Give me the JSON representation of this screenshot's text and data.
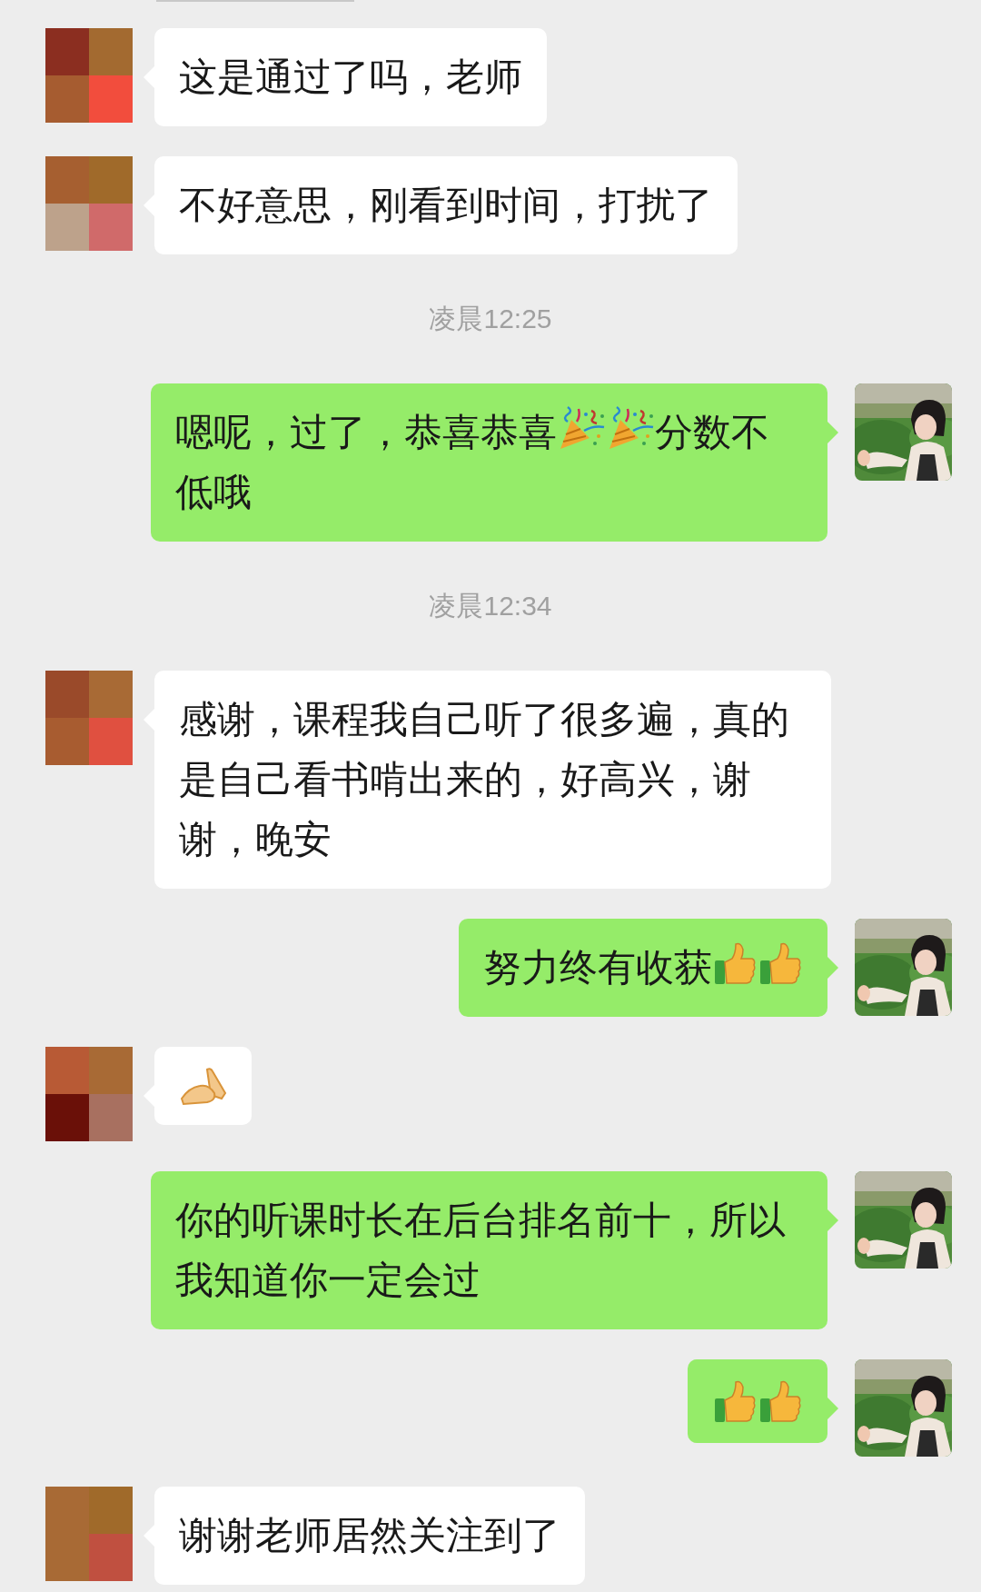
{
  "messages": [
    {
      "kind": "message",
      "outgoing": false,
      "parts": [
        {
          "kind": "text",
          "text": "这是通过了吗，老师"
        }
      ]
    },
    {
      "kind": "message",
      "outgoing": false,
      "parts": [
        {
          "kind": "text",
          "text": "不好意思，刚看到时间，打扰了"
        }
      ]
    },
    {
      "kind": "time",
      "text": "凌晨12:25"
    },
    {
      "kind": "message",
      "outgoing": true,
      "parts": [
        {
          "kind": "text",
          "text": "嗯呢，过了，恭喜恭喜"
        },
        {
          "kind": "party_popper"
        },
        {
          "kind": "party_popper"
        },
        {
          "kind": "text",
          "text": "分数不低哦"
        }
      ]
    },
    {
      "kind": "time",
      "text": "凌晨12:34"
    },
    {
      "kind": "message",
      "outgoing": false,
      "parts": [
        {
          "kind": "text",
          "text": "感谢，课程我自己听了很多遍，真的是自己看书啃出来的，好高兴，谢谢，晚安"
        }
      ]
    },
    {
      "kind": "message",
      "outgoing": true,
      "parts": [
        {
          "kind": "text",
          "text": "努力终有收获"
        },
        {
          "kind": "thumbs_up"
        },
        {
          "kind": "thumbs_up"
        }
      ]
    },
    {
      "kind": "message",
      "outgoing": false,
      "parts": [
        {
          "kind": "hands"
        }
      ]
    },
    {
      "kind": "message",
      "outgoing": true,
      "parts": [
        {
          "kind": "text",
          "text": "你的听课时长在后台排名前十，所以我知道你一定会过"
        }
      ]
    },
    {
      "kind": "message",
      "outgoing": true,
      "parts": [
        {
          "kind": "thumbs_up"
        },
        {
          "kind": "thumbs_up"
        }
      ]
    },
    {
      "kind": "message",
      "outgoing": false,
      "parts": [
        {
          "kind": "text",
          "text": "谢谢老师居然关注到了"
        }
      ]
    }
  ]
}
